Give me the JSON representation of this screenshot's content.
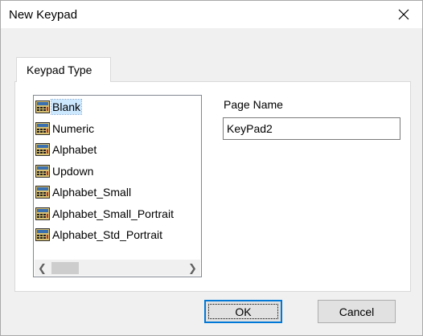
{
  "window": {
    "title": "New Keypad",
    "close_icon": "close-icon"
  },
  "tabs": [
    {
      "label": "Keypad Type",
      "active": true
    }
  ],
  "keypad_list": {
    "icon": "keypad-icon",
    "selected_index": 0,
    "items": [
      {
        "label": "Blank"
      },
      {
        "label": "Numeric"
      },
      {
        "label": "Alphabet"
      },
      {
        "label": "Updown"
      },
      {
        "label": "Alphabet_Small"
      },
      {
        "label": "Alphabet_Small_Portrait"
      },
      {
        "label": "Alphabet_Std_Portrait"
      }
    ],
    "scroll_left_icon": "scroll-left-icon",
    "scroll_right_icon": "scroll-right-icon"
  },
  "page_name": {
    "label": "Page Name",
    "value": "KeyPad2"
  },
  "buttons": {
    "ok": "OK",
    "cancel": "Cancel"
  },
  "colors": {
    "selection": "#cce8ff",
    "default_button_border": "#0078d7"
  }
}
